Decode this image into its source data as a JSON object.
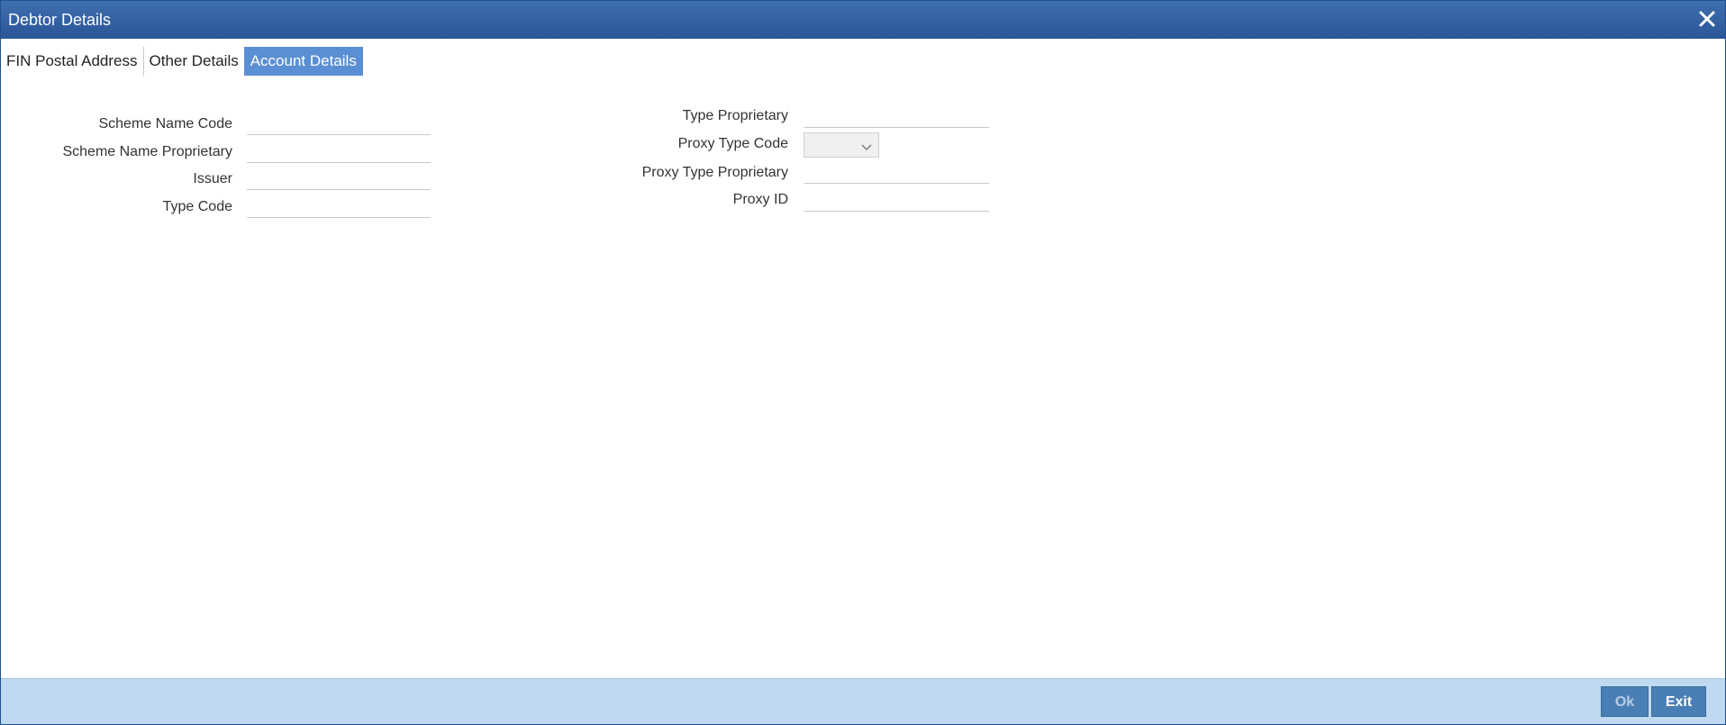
{
  "window": {
    "title": "Debtor Details",
    "close_icon": "close-icon"
  },
  "tabs": [
    {
      "label": "FIN Postal Address",
      "active": false
    },
    {
      "label": "Other Details",
      "active": false
    },
    {
      "label": "Account Details",
      "active": true
    }
  ],
  "left_fields": [
    {
      "label": "Scheme Name Code",
      "value": ""
    },
    {
      "label": "Scheme Name Proprietary",
      "value": ""
    },
    {
      "label": "Issuer",
      "value": ""
    },
    {
      "label": "Type Code",
      "value": ""
    }
  ],
  "right_fields": {
    "type_proprietary": {
      "label": "Type Proprietary",
      "value": ""
    },
    "proxy_type_code": {
      "label": "Proxy Type Code",
      "selected": ""
    },
    "proxy_type_proprietary": {
      "label": "Proxy Type Proprietary",
      "value": ""
    },
    "proxy_id": {
      "label": "Proxy ID",
      "value": ""
    }
  },
  "footer": {
    "ok_label": "Ok",
    "exit_label": "Exit"
  },
  "colors": {
    "titlebar": "#2f5e9f",
    "active_tab": "#5b8fd3",
    "footer": "#bfdaf0",
    "button": "#4a7fb5"
  }
}
